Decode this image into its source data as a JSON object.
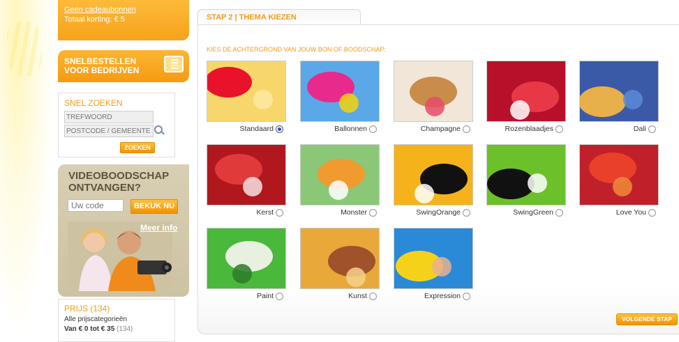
{
  "sidebar": {
    "gift": {
      "link": "Geen cadeaubonnen",
      "korting": "Totaal korting: € 5"
    },
    "snelbestellen": {
      "line1": "SNELBESTELLEN",
      "line2": "VOOR BEDRIJVEN"
    },
    "search": {
      "title": "SNEL ZOEKEN",
      "keyword_placeholder": "TREFWOORD",
      "location_placeholder": "POSTCODE / GEMEENTE",
      "button": "ZOEKEN"
    },
    "video": {
      "line1": "VIDEOBOODSCHAP",
      "line2": "ONTVANGEN?",
      "code_placeholder": "Uw code",
      "button": "BEKUK NU",
      "more_link": "Meer info"
    },
    "price": {
      "title": "PRIJS (134)",
      "all": "Alle prijscategorieën",
      "range": "Van € 0 tot € 35",
      "range_count": "(134)"
    }
  },
  "main": {
    "tab": "STAP 2 | THEMA KIEZEN",
    "instruction": "KIES DE ACHTERGROND VAN JOUW BON OF BOODSCHAP:",
    "themes": [
      {
        "label": "Standaard",
        "selected": true,
        "colors": [
          "#f7d76b",
          "#e8132a",
          "#ffe9a0"
        ]
      },
      {
        "label": "Ballonnen",
        "selected": false,
        "colors": [
          "#5aa8e8",
          "#e82a8c",
          "#f5d20c"
        ]
      },
      {
        "label": "Champagne",
        "selected": false,
        "colors": [
          "#f2e6d8",
          "#c98c4a",
          "#e84a6a"
        ]
      },
      {
        "label": "Rozenblaadjes",
        "selected": false,
        "colors": [
          "#b8102a",
          "#e83848",
          "#ffffff"
        ]
      },
      {
        "label": "Dali",
        "selected": false,
        "colors": [
          "#3a5aa8",
          "#e8b04a",
          "#5a8ad8"
        ]
      },
      {
        "label": "Kerst",
        "selected": false,
        "colors": [
          "#b0181e",
          "#e03a3a",
          "#f8e0e0"
        ]
      },
      {
        "label": "Monster",
        "selected": false,
        "colors": [
          "#8ac878",
          "#f09a30",
          "#ffffff"
        ]
      },
      {
        "label": "SwingOrange",
        "selected": false,
        "colors": [
          "#f5b21a",
          "#111111",
          "#ffffff"
        ]
      },
      {
        "label": "SwingGreen",
        "selected": false,
        "colors": [
          "#6cc02a",
          "#111111",
          "#ffffff"
        ]
      },
      {
        "label": "Love You",
        "selected": false,
        "colors": [
          "#c0202a",
          "#e8402a",
          "#f08a3a"
        ]
      },
      {
        "label": "Paint",
        "selected": false,
        "colors": [
          "#4ab83a",
          "#e8f0e0",
          "#2a7a2a"
        ]
      },
      {
        "label": "Kunst",
        "selected": false,
        "colors": [
          "#e8a83a",
          "#a0522a",
          "#f5d28a"
        ]
      },
      {
        "label": "Expression",
        "selected": false,
        "colors": [
          "#2a8ad8",
          "#f5d21a",
          "#e8b090"
        ]
      }
    ],
    "next_button": "VOLGENDE STAP"
  }
}
